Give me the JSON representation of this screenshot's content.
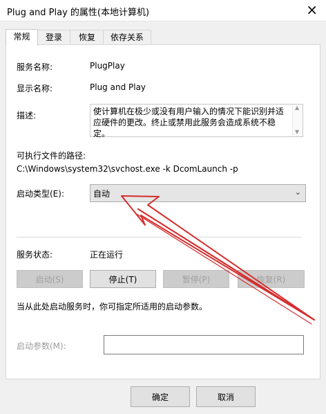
{
  "window": {
    "title": "Plug and Play 的属性(本地计算机)",
    "close_glyph": "×"
  },
  "tabs": [
    {
      "label": "常规"
    },
    {
      "label": "登录"
    },
    {
      "label": "恢复"
    },
    {
      "label": "依存关系"
    }
  ],
  "general": {
    "service_name_label": "服务名称:",
    "service_name": "PlugPlay",
    "display_name_label": "显示名称:",
    "display_name": "Plug and Play",
    "description_label": "描述:",
    "description": "使计算机在极少或没有用户输入的情况下能识别并适应硬件的更改。终止或禁用此服务会造成系统不稳定。",
    "exe_path_label": "可执行文件的路径:",
    "exe_path": "C:\\Windows\\system32\\svchost.exe -k DcomLaunch -p",
    "startup_type_label": "启动类型(E):",
    "startup_type": "自动",
    "status_label": "服务状态:",
    "status": "正在运行",
    "buttons": {
      "start": "启动(S)",
      "stop": "停止(T)",
      "pause": "暂停(P)",
      "resume": "恢复(R)"
    },
    "hint": "当从此处启动服务时，你可指定所适用的启动参数。",
    "params_label": "启动参数(M):",
    "params_value": ""
  },
  "footer": {
    "ok": "确定",
    "cancel": "取消"
  },
  "colors": {
    "annotation_arrow": "#d42d2d"
  },
  "icons": {
    "close": "close-icon",
    "dropdown": "chevron-down-icon",
    "scroll_up": "scroll-up-icon",
    "scroll_down": "scroll-down-icon"
  }
}
